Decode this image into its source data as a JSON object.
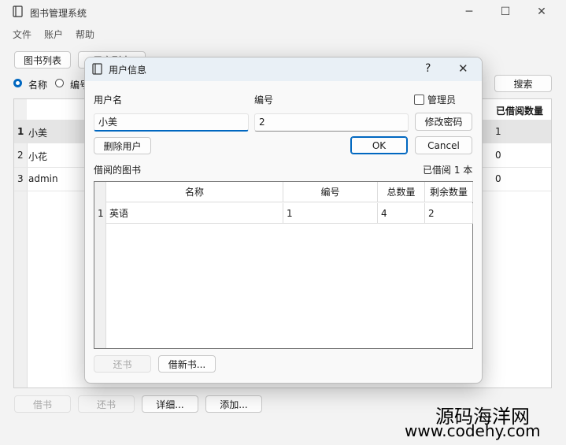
{
  "window": {
    "title": "图书管理系统",
    "menu": [
      "文件",
      "账户",
      "帮助"
    ],
    "controls": [
      "minimize-icon",
      "maximize-icon",
      "close-icon"
    ]
  },
  "main": {
    "tabs": [
      "图书列表",
      "用户列表"
    ],
    "search": {
      "options": [
        "名称",
        "编号"
      ],
      "selected": "名称",
      "button": "搜索"
    },
    "table": {
      "last_header": "已借阅数量",
      "rows": [
        {
          "index": "1",
          "name": "小美",
          "count": "1"
        },
        {
          "index": "2",
          "name": "小花",
          "count": "0"
        },
        {
          "index": "3",
          "name": "admin",
          "count": "0"
        }
      ]
    },
    "buttons": {
      "borrow": "借书",
      "return": "还书",
      "detail": "详细...",
      "add": "添加..."
    }
  },
  "dialog": {
    "title": "用户信息",
    "help": "?",
    "username_label": "用户名",
    "username_value": "小美",
    "id_label": "编号",
    "id_value": "2",
    "admin_label": "管理员",
    "admin_checked": false,
    "change_password": "修改密码",
    "delete_user": "删除用户",
    "ok": "OK",
    "cancel": "Cancel",
    "borrowed_label": "借阅的图书",
    "borrowed_count": "已借阅 1 本",
    "loans": {
      "headers": [
        "名称",
        "编号",
        "总数量",
        "剩余数量"
      ],
      "rows": [
        {
          "index": "1",
          "name": "英语",
          "id": "1",
          "total": "4",
          "remaining": "2"
        }
      ]
    },
    "return_book": "还书",
    "borrow_new": "借新书..."
  },
  "watermark": {
    "line1": "源码海洋网",
    "line2": "www.codehy.com"
  },
  "colors": {
    "accent": "#0067c0",
    "selected_row": "#e5e5e5",
    "dialog_title": "#e9f0f6"
  }
}
